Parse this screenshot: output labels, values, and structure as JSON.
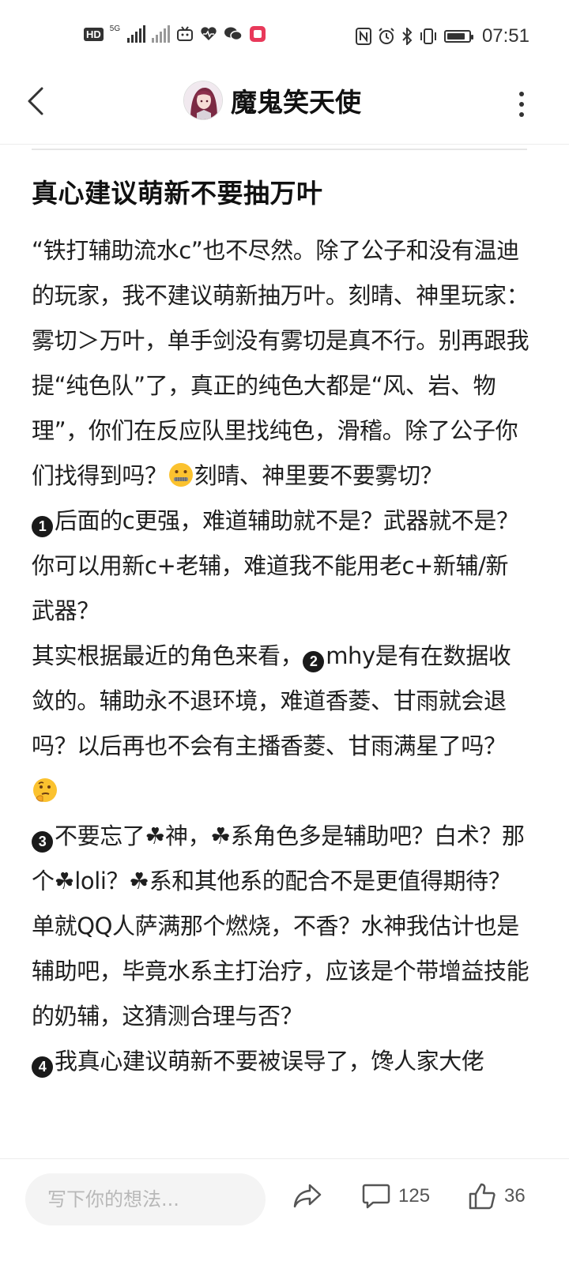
{
  "status_bar": {
    "network_badge": "HD",
    "signal_label": "5G",
    "time": "07:51",
    "battery_level": 0.85
  },
  "header": {
    "author_name": "魔鬼笑天使"
  },
  "article": {
    "title": "真心建议萌新不要抽万叶",
    "paragraphs": [
      {
        "text": "“铁打辅助流水c”也不尽然。除了公子和没有温迪的玩家，我不建议萌新抽万叶。刻晴、神里玩家：雾切＞万叶，单手剑没有雾切是真不行。别再跟我提“纯色队”了，真正的纯色大都是“风、岩、物理”，你们在反应队里找纯色，滑稽。除了公子你们找得到吗？",
        "emoji": "zipper-mouth",
        "tail": "刻晴、神里要不要雾切？"
      },
      {
        "num": "1",
        "text": "后面的c更强，难道辅助就不是？武器就不是？你可以用新c+老辅，难道我不能用老c+新辅/新武器？"
      },
      {
        "pre": "其实根据最近的角色来看，",
        "num": "2",
        "text": "mhy是有在数据收敛的。辅助永不退环境，难道香菱、甘雨就会退吗？以后再也不会有主播香菱、甘雨满星了吗？",
        "emoji": "thinking"
      },
      {
        "num": "3",
        "text": "不要忘了☘神，☘系角色多是辅助吧？白术？那个☘loli？☘系和其他系的配合不是更值得期待？单就QQ人萨满那个燃烧，不香？水神我估计也是辅助吧，毕竟水系主打治疗，应该是个带增益技能的奶辅，这猜测合理与否？"
      },
      {
        "num": "4",
        "text": "我真心建议萌新不要被误导了，馋人家大佬"
      }
    ]
  },
  "bottom_bar": {
    "comment_placeholder": "写下你的想法...",
    "comment_count": "125",
    "like_count": "36"
  }
}
